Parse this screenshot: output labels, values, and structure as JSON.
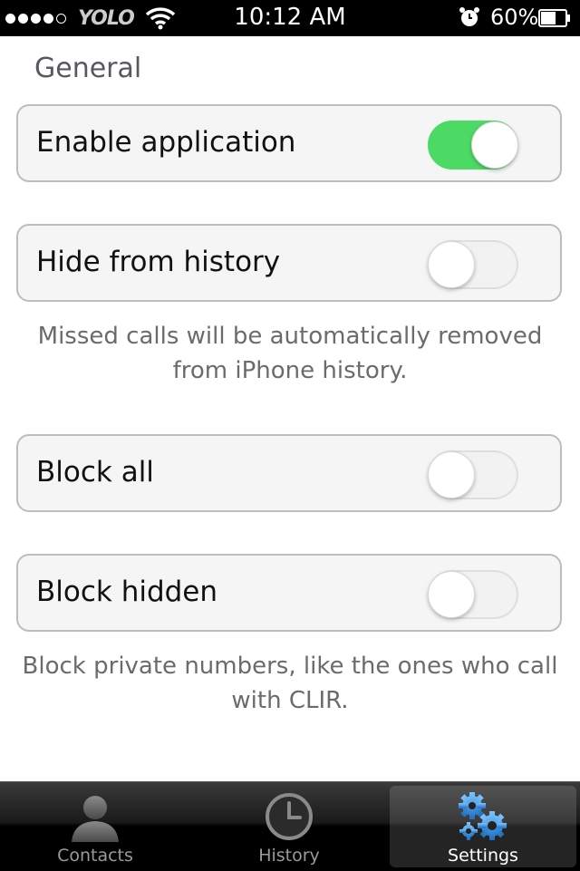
{
  "status_bar": {
    "carrier": "YOLO",
    "time": "10:12 AM",
    "battery_percent": "60%",
    "signal_strength_dots": 4,
    "battery_level": 0.6,
    "icons": [
      "signal-dots-icon",
      "wifi-icon",
      "alarm-icon",
      "battery-icon"
    ]
  },
  "settings": {
    "section_title": "General",
    "rows": [
      {
        "label": "Enable application",
        "on": true
      },
      {
        "label": "Hide from history",
        "on": false
      },
      {
        "label": "Block all",
        "on": false
      },
      {
        "label": "Block hidden",
        "on": false
      }
    ],
    "notes": [
      "Missed calls will be automatically removed from iPhone history.",
      "Block private numbers, like the ones who call with CLIR."
    ]
  },
  "colors": {
    "toggle_on": "#4cd964",
    "tab_selected_icon": "#3b8fd6"
  },
  "tab_bar": {
    "tabs": [
      {
        "label": "Contacts",
        "icon": "person-icon",
        "selected": false
      },
      {
        "label": "History",
        "icon": "clock-icon",
        "selected": false
      },
      {
        "label": "Settings",
        "icon": "gears-icon",
        "selected": true
      }
    ]
  }
}
